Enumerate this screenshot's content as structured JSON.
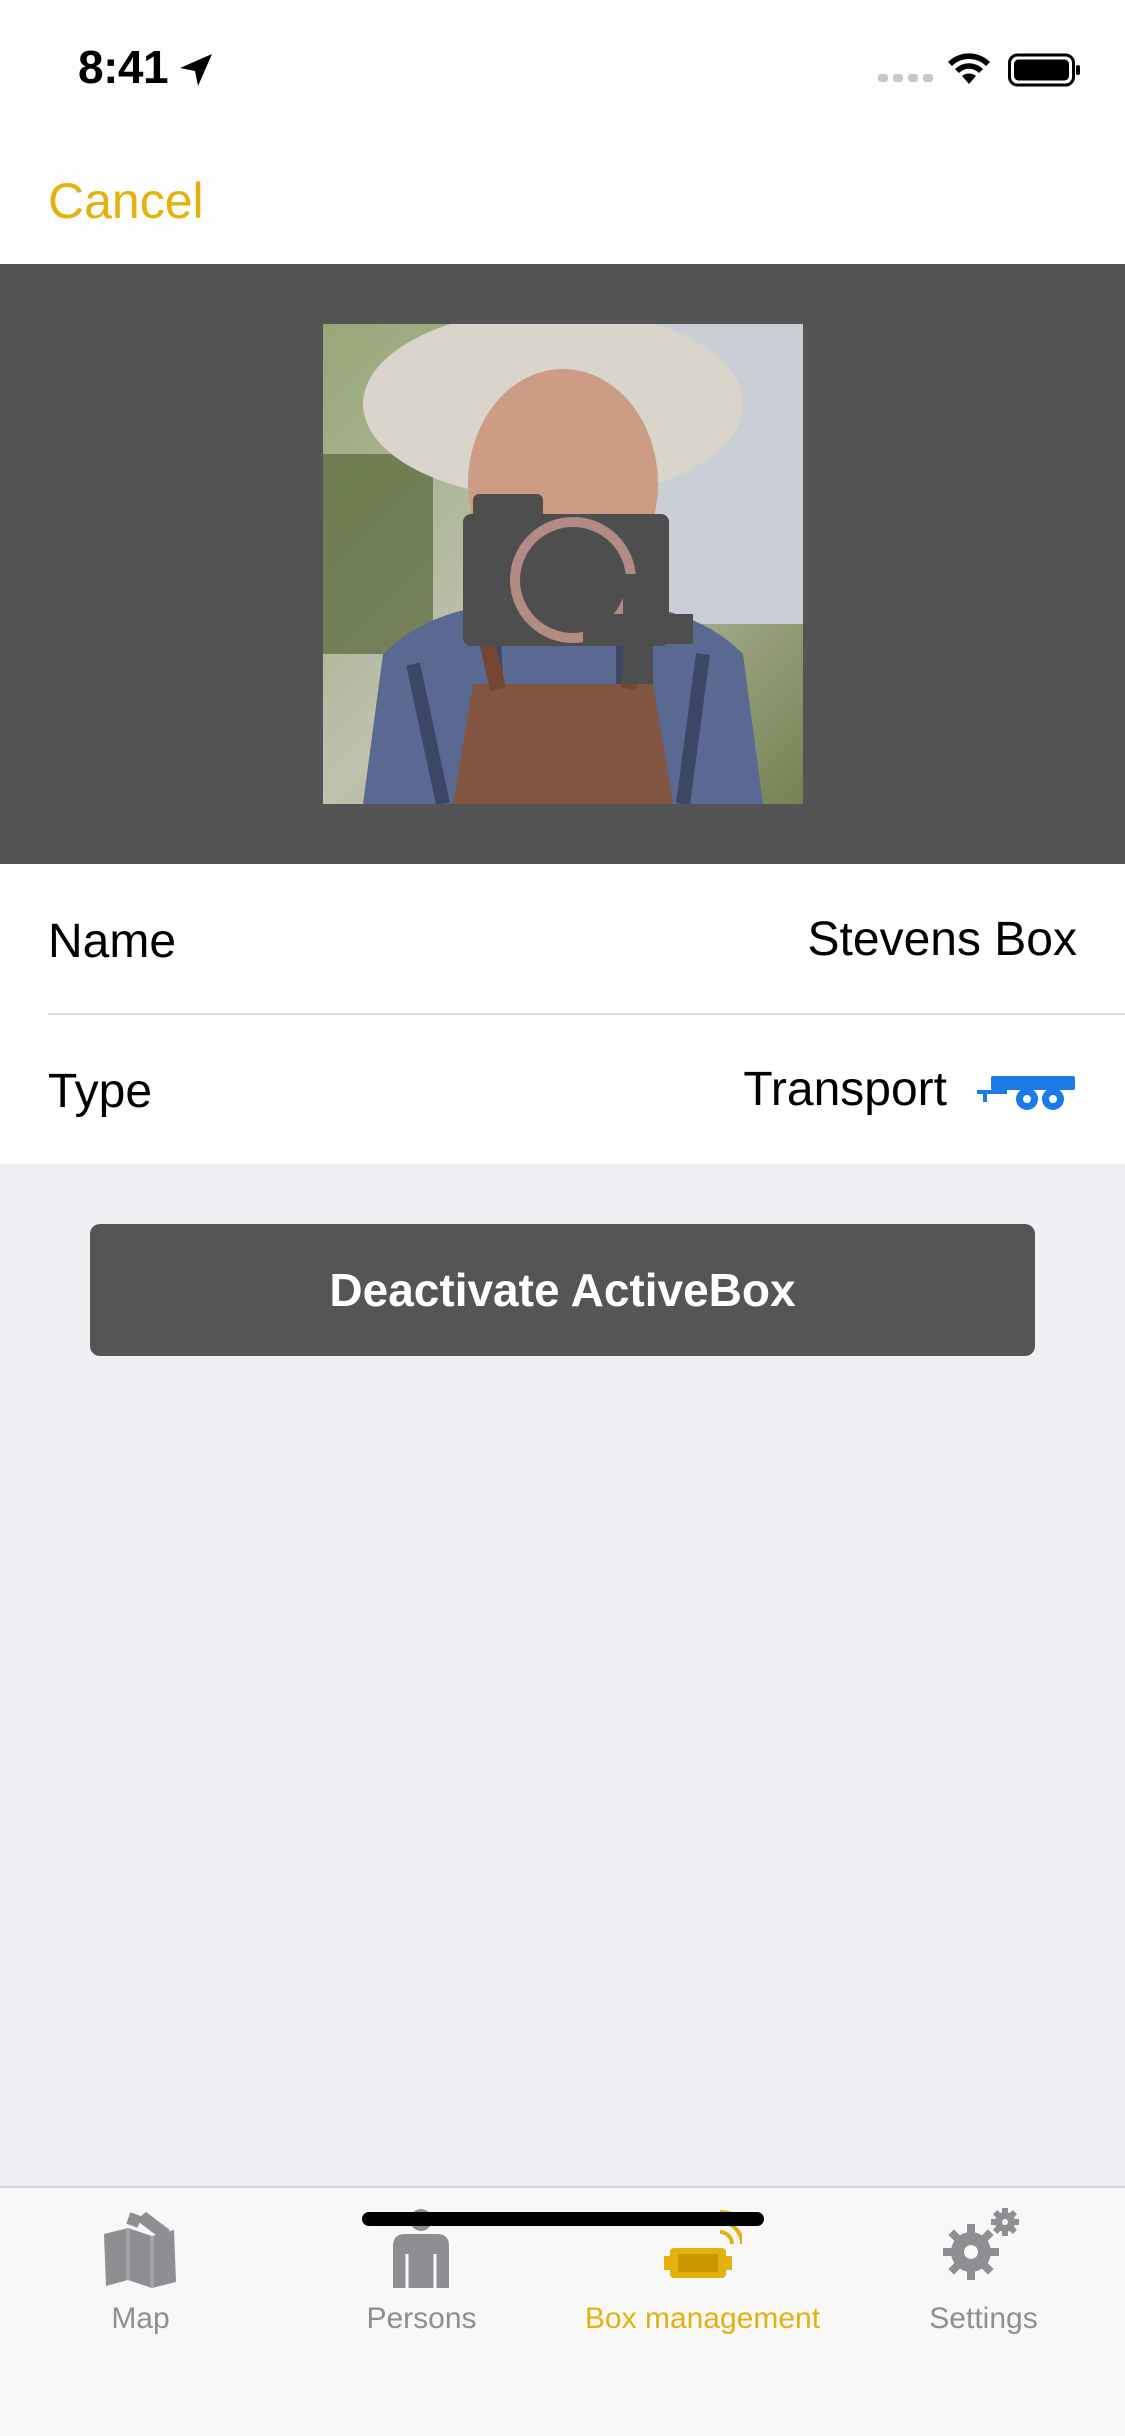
{
  "status_bar": {
    "time": "8:41"
  },
  "nav": {
    "cancel_label": "Cancel"
  },
  "photo": {
    "action": "add-photo",
    "icon": "camera-plus-icon"
  },
  "form": {
    "name_label": "Name",
    "name_value": "Stevens Box",
    "type_label": "Type",
    "type_value": "Transport",
    "type_icon": "trailer-icon"
  },
  "actions": {
    "deactivate_label": "Deactivate ActiveBox"
  },
  "tab_bar": {
    "tabs": [
      {
        "label": "Map",
        "icon": "map-icon",
        "selected": false
      },
      {
        "label": "Persons",
        "icon": "person-icon",
        "selected": false
      },
      {
        "label": "Box management",
        "icon": "box-icon",
        "selected": true
      },
      {
        "label": "Settings",
        "icon": "gear-icon",
        "selected": false
      }
    ]
  },
  "colors": {
    "accent": "#e3b20f",
    "header_bg": "#545454",
    "button_bg": "#555555",
    "trailer_blue": "#1a7be8",
    "tab_inactive": "#8e8e93"
  }
}
